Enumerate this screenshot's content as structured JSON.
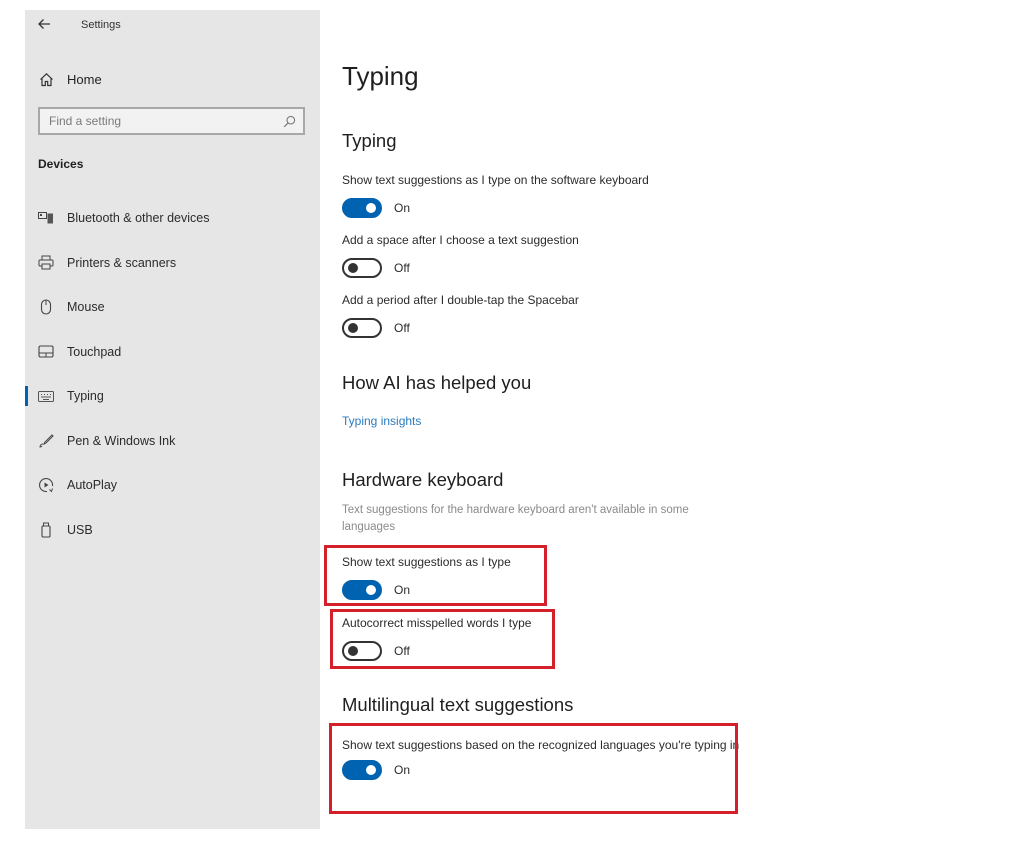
{
  "window": {
    "app_title": "Settings",
    "back_icon": "back-arrow-icon"
  },
  "sidebar": {
    "home": {
      "label": "Home",
      "icon": "home-icon"
    },
    "search": {
      "placeholder": "Find a setting",
      "value": "",
      "icon": "search-icon"
    },
    "section_label": "Devices",
    "items": [
      {
        "label": "Bluetooth & other devices",
        "icon": "bluetooth-devices-icon",
        "active": false
      },
      {
        "label": "Printers & scanners",
        "icon": "printer-icon",
        "active": false
      },
      {
        "label": "Mouse",
        "icon": "mouse-icon",
        "active": false
      },
      {
        "label": "Touchpad",
        "icon": "touchpad-icon",
        "active": false
      },
      {
        "label": "Typing",
        "icon": "keyboard-icon",
        "active": true
      },
      {
        "label": "Pen & Windows Ink",
        "icon": "pen-icon",
        "active": false
      },
      {
        "label": "AutoPlay",
        "icon": "autoplay-icon",
        "active": false
      },
      {
        "label": "USB",
        "icon": "usb-icon",
        "active": false
      }
    ]
  },
  "main": {
    "page_title": "Typing",
    "sections": {
      "typing": {
        "title": "Typing",
        "settings": [
          {
            "label": "Show text suggestions as I type on the software keyboard",
            "state": "On",
            "on": true
          },
          {
            "label": "Add a space after I choose a text suggestion",
            "state": "Off",
            "on": false
          },
          {
            "label": "Add a period after I double-tap the Spacebar",
            "state": "Off",
            "on": false
          }
        ]
      },
      "ai": {
        "title": "How AI has helped you",
        "link": "Typing insights"
      },
      "hardware": {
        "title": "Hardware keyboard",
        "hint": "Text suggestions for the hardware keyboard aren't available in some languages",
        "settings": [
          {
            "label": "Show text suggestions as I type",
            "state": "On",
            "on": true
          },
          {
            "label": "Autocorrect misspelled words I type",
            "state": "Off",
            "on": false
          }
        ]
      },
      "multilingual": {
        "title": "Multilingual text suggestions",
        "settings": [
          {
            "label": "Show text suggestions based on the recognized languages you're typing in",
            "state": "On",
            "on": true
          }
        ]
      }
    }
  },
  "colors": {
    "accent": "#0063b1",
    "link": "#2a7bc0",
    "highlight": "#d3202a",
    "sidebar_bg": "#e6e6e6"
  }
}
